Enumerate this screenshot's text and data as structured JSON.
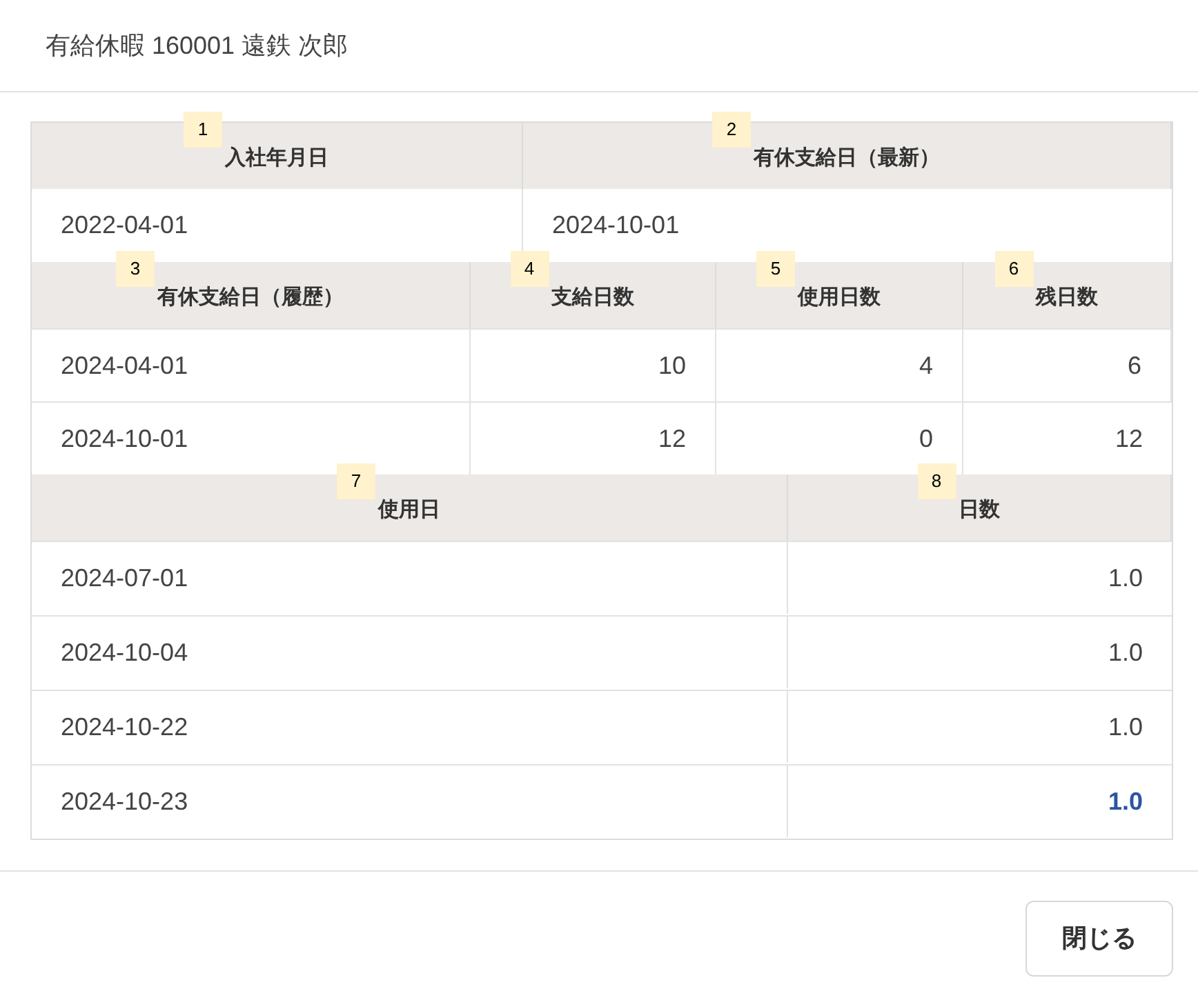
{
  "dialog": {
    "title": "有給休暇 160001 遠鉄 次郎"
  },
  "joining": {
    "columns": [
      {
        "label": "入社年月日",
        "marker": "1"
      },
      {
        "label": "有休支給日（最新）",
        "marker": "2"
      }
    ],
    "row": [
      "2022-04-01",
      "2024-10-01"
    ]
  },
  "grants": {
    "columns": [
      {
        "label": "有休支給日（履歴）",
        "marker": "3"
      },
      {
        "label": "支給日数",
        "marker": "4"
      },
      {
        "label": "使用日数",
        "marker": "5"
      },
      {
        "label": "残日数",
        "marker": "6"
      }
    ],
    "rows": [
      [
        "2024-04-01",
        "10",
        "4",
        "6"
      ],
      [
        "2024-10-01",
        "12",
        "0",
        "12"
      ]
    ]
  },
  "usage": {
    "columns": [
      {
        "label": "使用日",
        "marker": "7"
      },
      {
        "label": "日数",
        "marker": "8"
      }
    ],
    "rows": [
      {
        "date": "2024-07-01",
        "days": "1.0",
        "highlighted": false
      },
      {
        "date": "2024-10-04",
        "days": "1.0",
        "highlighted": false
      },
      {
        "date": "2024-10-22",
        "days": "1.0",
        "highlighted": false
      },
      {
        "date": "2024-10-23",
        "days": "1.0",
        "highlighted": true
      }
    ]
  },
  "buttons": [
    {
      "label": "閉じる"
    }
  ]
}
